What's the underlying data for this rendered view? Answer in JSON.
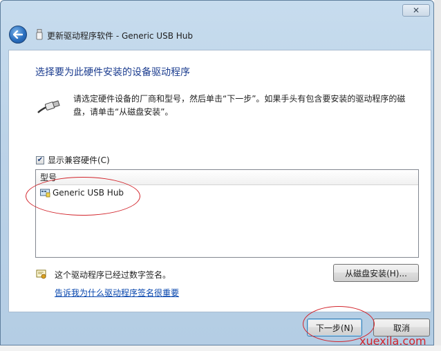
{
  "window": {
    "title": "更新驱动程序软件 - Generic USB Hub",
    "close_glyph": "✕"
  },
  "icons": {
    "back": "back-arrow-icon",
    "usb_small": "usb-device-icon",
    "usb_big": "usb-cable-icon",
    "hub": "usb-hub-icon",
    "signed": "certificate-icon"
  },
  "page": {
    "heading": "选择要为此硬件安装的设备驱动程序",
    "description": "请选定硬件设备的厂商和型号，然后单击“下一步”。如果手头有包含要安装的驱动程序的磁盘，请单击“从磁盘安装”。",
    "show_compatible": {
      "label": "显示兼容硬件(C)",
      "checked": true
    },
    "list": {
      "header": "型号",
      "items": [
        {
          "label": "Generic USB Hub"
        }
      ]
    },
    "signed_text": "这个驱动程序已经过数字签名。",
    "signed_link": "告诉我为什么驱动程序签名很重要",
    "disk_button": "从磁盘安装(H)..."
  },
  "footer": {
    "next_button": "下一步(N)",
    "cancel_button": "取消"
  },
  "watermark": "xuexila.com",
  "colors": {
    "heading": "#1b3c8f",
    "link": "#0645ad",
    "annotation": "#d2232a"
  }
}
